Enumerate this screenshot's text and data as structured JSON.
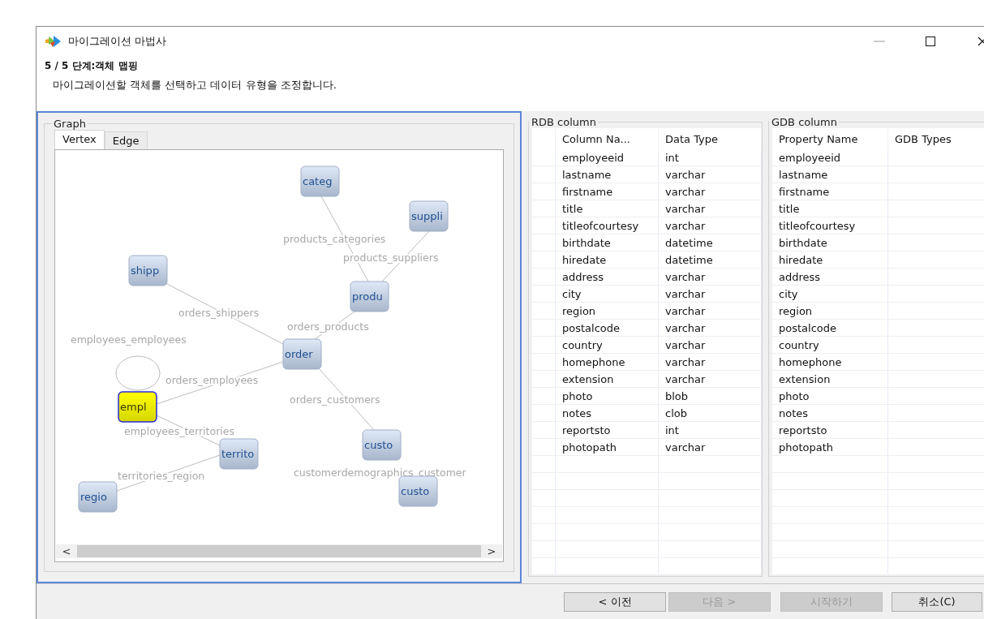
{
  "window": {
    "title": "마이그레이션 마법사"
  },
  "step": {
    "title": "5 / 5 단계:객체 맵핑",
    "description": "마이그레이션할 객체를 선택하고 데이터 유형을 조정합니다."
  },
  "graph": {
    "legend": "Graph",
    "tabs": [
      {
        "label": "Vertex",
        "selected": true
      },
      {
        "label": "Edge",
        "selected": false
      }
    ],
    "nodes": [
      {
        "label": "categ",
        "selected": false
      },
      {
        "label": "suppli",
        "selected": false
      },
      {
        "label": "shipp",
        "selected": false
      },
      {
        "label": "produ",
        "selected": false
      },
      {
        "label": "order",
        "selected": false
      },
      {
        "label": "empl",
        "selected": true
      },
      {
        "label": "territo",
        "selected": false
      },
      {
        "label": "custo",
        "selected": false
      },
      {
        "label": "custo",
        "selected": false
      },
      {
        "label": "regio",
        "selected": false
      }
    ],
    "edges": [
      {
        "label": "products_categories"
      },
      {
        "label": "products_suppliers"
      },
      {
        "label": "orders_shippers"
      },
      {
        "label": "orders_products"
      },
      {
        "label": "employees_employees"
      },
      {
        "label": "orders_employees"
      },
      {
        "label": "orders_customers"
      },
      {
        "label": "employees_territories"
      },
      {
        "label": "territories_region"
      },
      {
        "label": "customerdemographics_customer"
      }
    ],
    "scroll_left": "<",
    "scroll_right": ">"
  },
  "rdb": {
    "legend": "RDB column",
    "columns": [
      "Column Na...",
      "Data Type"
    ],
    "rows": [
      [
        "employeeid",
        "int"
      ],
      [
        "lastname",
        "varchar"
      ],
      [
        "firstname",
        "varchar"
      ],
      [
        "title",
        "varchar"
      ],
      [
        "titleofcourtesy",
        "varchar"
      ],
      [
        "birthdate",
        "datetime"
      ],
      [
        "hiredate",
        "datetime"
      ],
      [
        "address",
        "varchar"
      ],
      [
        "city",
        "varchar"
      ],
      [
        "region",
        "varchar"
      ],
      [
        "postalcode",
        "varchar"
      ],
      [
        "country",
        "varchar"
      ],
      [
        "homephone",
        "varchar"
      ],
      [
        "extension",
        "varchar"
      ],
      [
        "photo",
        "blob"
      ],
      [
        "notes",
        "clob"
      ],
      [
        "reportsto",
        "int"
      ],
      [
        "photopath",
        "varchar"
      ]
    ]
  },
  "gdb": {
    "legend": "GDB column",
    "columns": [
      "Property Name",
      "GDB Types"
    ],
    "rows": [
      "employeeid",
      "lastname",
      "firstname",
      "title",
      "titleofcourtesy",
      "birthdate",
      "hiredate",
      "address",
      "city",
      "region",
      "postalcode",
      "country",
      "homephone",
      "extension",
      "photo",
      "notes",
      "reportsto",
      "photopath"
    ]
  },
  "buttons": [
    {
      "label": "< 이전",
      "disabled": false
    },
    {
      "label": "다음 >",
      "disabled": true
    },
    {
      "label": "시작하기",
      "disabled": true
    },
    {
      "label": "취소(C)",
      "disabled": false
    }
  ]
}
